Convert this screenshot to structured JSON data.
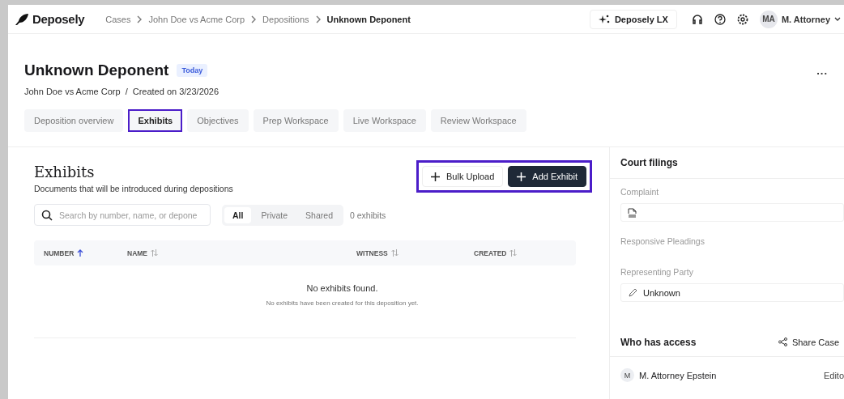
{
  "header": {
    "logo": "Deposely",
    "breadcrumbs": [
      {
        "label": "Cases",
        "current": false
      },
      {
        "label": "John Doe vs Acme Corp",
        "current": false
      },
      {
        "label": "Depositions",
        "current": false
      },
      {
        "label": "Unknown Deponent",
        "current": true
      }
    ],
    "assistant_button": "Deposely LX",
    "user": {
      "initials": "MA",
      "name": "M. Attorney"
    }
  },
  "page": {
    "title": "Unknown Deponent",
    "badge": "Today",
    "case": "John Doe vs Acme Corp",
    "separator": "/",
    "created": "Created on 3/23/2026",
    "more": "..."
  },
  "tabs": [
    {
      "label": "Deposition overview",
      "selected": false,
      "highlighted": false
    },
    {
      "label": "Exhibits",
      "selected": true,
      "highlighted": true
    },
    {
      "label": "Objectives",
      "selected": false,
      "highlighted": false
    },
    {
      "label": "Prep Workspace",
      "selected": false,
      "highlighted": false
    },
    {
      "label": "Live Workspace",
      "selected": false,
      "highlighted": false
    },
    {
      "label": "Review Workspace",
      "selected": false,
      "highlighted": false
    }
  ],
  "exhibits": {
    "title": "Exhibits",
    "subtitle": "Documents that will be introduced during depositions",
    "actions_highlighted": true,
    "buttons": [
      {
        "label": "Bulk Upload",
        "kind": "secondary"
      },
      {
        "label": "Add Exhibit",
        "kind": "primary"
      }
    ],
    "search": {
      "placeholder": "Search by number, name, or depone"
    },
    "filters": [
      {
        "label": "All",
        "selected": true
      },
      {
        "label": "Private",
        "selected": false
      },
      {
        "label": "Shared",
        "selected": false
      }
    ],
    "count": "0 exhibits",
    "columns": [
      {
        "label": "NUMBER",
        "sorted": true
      },
      {
        "label": "NAME",
        "sorted": false
      },
      {
        "label": "WITNESS",
        "sorted": false
      },
      {
        "label": "CREATED",
        "sorted": false
      }
    ],
    "empty_title": "No exhibits found.",
    "empty_text": "No exhibits have been created for this deposition yet."
  },
  "court_filings": {
    "title": "Court filings",
    "complaint_label": "Complaint",
    "responsive_label": "Responsive Pleadings",
    "party_label": "Representing Party",
    "party_value": "Unknown"
  },
  "access": {
    "title": "Who has access",
    "share": "Share Case",
    "members": [
      {
        "initial": "M",
        "name": "M. Attorney Epstein",
        "role": "Edito"
      }
    ]
  }
}
